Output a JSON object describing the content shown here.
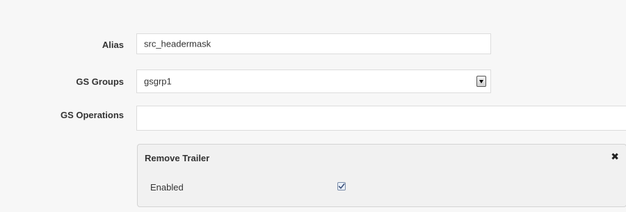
{
  "form": {
    "alias": {
      "label": "Alias",
      "value": "src_headermask"
    },
    "gs_groups": {
      "label": "GS Groups",
      "selected": "gsgrp1"
    },
    "gs_operations": {
      "label": "GS Operations",
      "value": ""
    }
  },
  "operation": {
    "title": "Remove Trailer",
    "close_icon": "close-icon",
    "enabled_label": "Enabled",
    "enabled_checked": true
  }
}
